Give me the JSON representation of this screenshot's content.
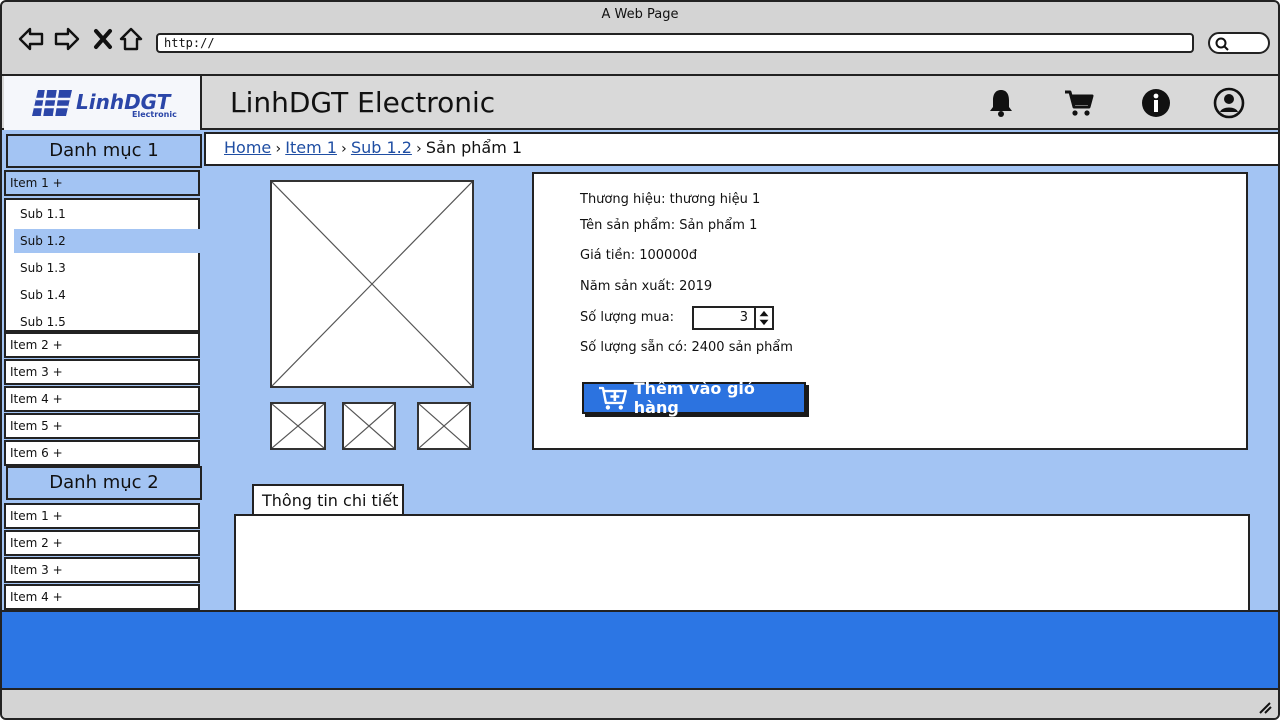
{
  "browser": {
    "window_title": "A Web Page",
    "url": "http://"
  },
  "header": {
    "logo_text": "LinhDGT",
    "logo_sub": "Electronic",
    "site_title": "LinhDGT Electronic",
    "icons": [
      "bell-icon",
      "cart-icon",
      "info-icon",
      "user-icon"
    ]
  },
  "sidebar": {
    "cat1": {
      "title": "Danh mục 1",
      "items": [
        "Item 1 +",
        "Item 2 +",
        "Item 3 +",
        "Item 4 +",
        "Item 5 +",
        "Item 6 +"
      ],
      "subitems": [
        "Sub 1.1",
        "Sub 1.2",
        "Sub 1.3",
        "Sub 1.4",
        "Sub 1.5"
      ],
      "selected_sub": "Sub 1.2"
    },
    "cat2": {
      "title": "Danh mục 2",
      "items": [
        "Item 1 +",
        "Item 2 +",
        "Item 3 +",
        "Item 4 +"
      ]
    }
  },
  "breadcrumb": {
    "home": "Home",
    "item": "Item 1",
    "sub": "Sub 1.2",
    "current": "Sản phẩm 1"
  },
  "product": {
    "brand": "Thương hiệu: thương hiệu 1",
    "name": "Tên sản phẩm: Sản phẩm 1",
    "price": "Giá tiền: 100000đ",
    "year": "Năm sản xuất: 2019",
    "qty_label": "Số lượng mua:",
    "qty_value": "3",
    "stock": "Số lượng sẵn có: 2400 sản phẩm",
    "add_to_cart": "Thêm vào giỏ hàng"
  },
  "tabs": {
    "detail": "Thông tin chi tiết"
  },
  "colors": {
    "accent": "#2c73e0",
    "panel_bg": "#a3c4f3",
    "logo": "#2b46a8"
  }
}
